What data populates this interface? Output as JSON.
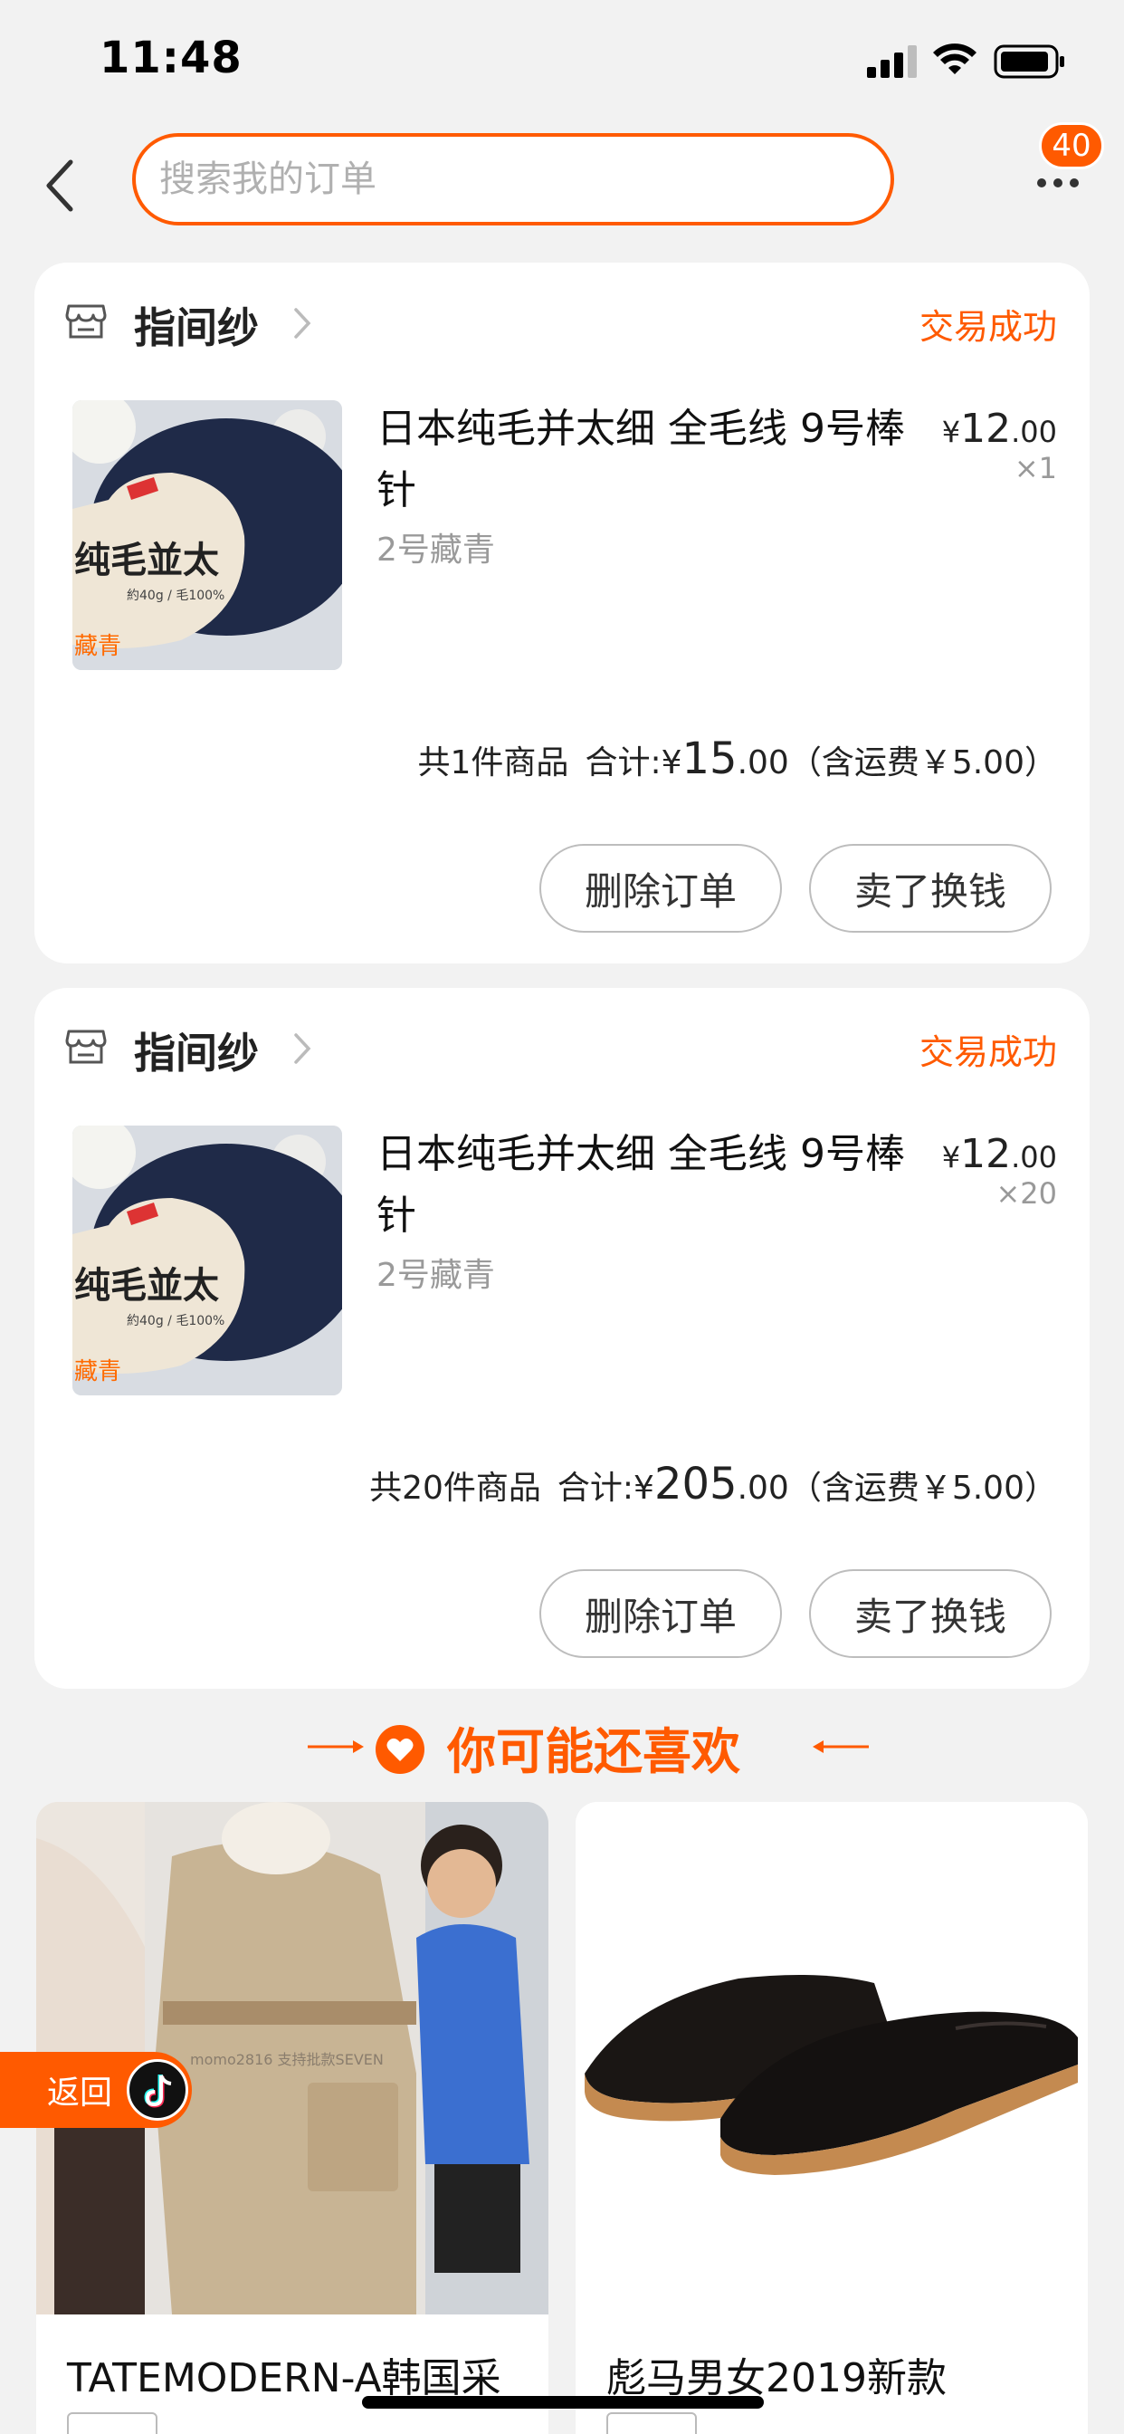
{
  "status_bar": {
    "time": "11:48"
  },
  "header": {
    "search_placeholder": "搜索我的订单",
    "badge_count": "40"
  },
  "orders": [
    {
      "shop_name": "指间纱",
      "status": "交易成功",
      "product_title": "日本纯毛并太细 全毛线 9号棒针",
      "product_spec": "2号藏青",
      "price_currency": "¥",
      "price_int": "12",
      "price_dec": ".00",
      "quantity": "×1",
      "summary_count": "共1件商品",
      "summary_total_label": "合计:",
      "summary_currency": "¥",
      "summary_total_int": "15",
      "summary_total_dec": ".00",
      "summary_shipping": "（含运费￥5.00）",
      "delete_label": "删除订单",
      "sell_label": "卖了换钱"
    },
    {
      "shop_name": "指间纱",
      "status": "交易成功",
      "product_title": "日本纯毛并太细 全毛线 9号棒针",
      "product_spec": "2号藏青",
      "price_currency": "¥",
      "price_int": "12",
      "price_dec": ".00",
      "quantity": "×20",
      "summary_count": "共20件商品",
      "summary_total_label": "合计:",
      "summary_currency": "¥",
      "summary_total_int": "205",
      "summary_total_dec": ".00",
      "summary_shipping": "（含运费￥5.00）",
      "delete_label": "删除订单",
      "sell_label": "卖了换钱"
    }
  ],
  "recommend": {
    "title": "你可能还喜欢",
    "items": [
      {
        "title": "TATEMODERN-A韩国采"
      },
      {
        "title": "彪马男女2019新款"
      }
    ]
  },
  "float_return": {
    "label": "返回"
  },
  "colors": {
    "accent": "#ff5a00",
    "background": "#f2f2f2"
  }
}
